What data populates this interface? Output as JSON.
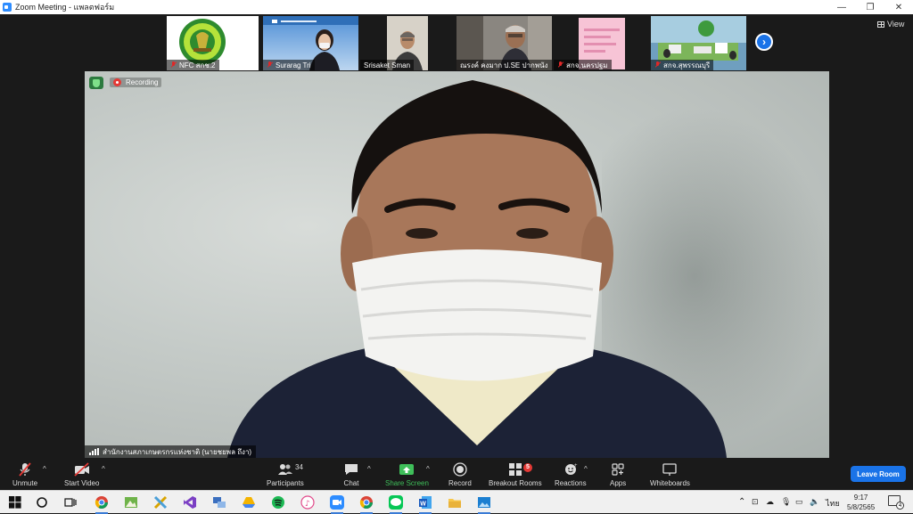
{
  "window": {
    "title": "Zoom Meeting - แพลตฟอร์ม",
    "minimize": "—",
    "restore": "❐",
    "close": "✕"
  },
  "strip": {
    "tiles": [
      {
        "name": "NFC สกช.2"
      },
      {
        "name": "Surarag Tri"
      },
      {
        "name": "Srisaket Sman"
      },
      {
        "name": "ณรงค์ คงมาก ป.SE ปากพนัง"
      },
      {
        "name": "สกจ.นครปฐม"
      },
      {
        "name": "สกจ.สุพรรณบุรี"
      }
    ],
    "next_icon": "›",
    "view_label": "View"
  },
  "main": {
    "recording_label": "Recording",
    "speaker_name": "สำนักงานสภาเกษตรกรแห่งชาติ (นายชยพล ถึงา)"
  },
  "toolbar": {
    "unmute": "Unmute",
    "start_video": "Start Video",
    "participants": "Participants",
    "participants_count": "34",
    "chat": "Chat",
    "share_screen": "Share Screen",
    "record": "Record",
    "breakout_rooms": "Breakout Rooms",
    "breakout_badge": "5",
    "reactions": "Reactions",
    "apps": "Apps",
    "whiteboards": "Whiteboards",
    "leave": "Leave Room",
    "caret": "^"
  },
  "taskbar": {
    "language": "ไทย",
    "time": "9:17",
    "date": "5/8/2565",
    "notifications": "4"
  },
  "colors": {
    "accent": "#1a73e8",
    "share_green": "#3fbf5a",
    "recording_red": "#e53935"
  }
}
